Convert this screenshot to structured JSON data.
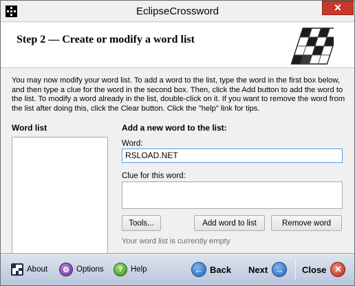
{
  "window": {
    "title": "EclipseCrossword",
    "close_glyph": "✕"
  },
  "header": {
    "title": "Step 2 — Create or modify a word list",
    "logo_icon": "crossword-grid-logo"
  },
  "instructions": "You may now modify your word list.  To add a word to the list, type the word in the first box below, and then type a clue for the word in the second box.  Then, click the Add button to add the word to the list.  To modify a word already in the list, double-click on it.  If you want to remove the word from the list after doing this, click the Clear button.  Click the \"help\" link for tips.",
  "word_list": {
    "label": "Word list",
    "items": []
  },
  "add_panel": {
    "heading": "Add a new word to the list:",
    "word_label": "Word:",
    "word_value": "RSLOAD.NET",
    "clue_label": "Clue for this word:",
    "clue_value": "",
    "tools_label": "Tools...",
    "add_label": "Add word to list",
    "remove_label": "Remove word",
    "status": "Your word list is currently empty"
  },
  "footer": {
    "about": {
      "label": "About",
      "icon": "crossword-icon"
    },
    "options": {
      "label": "Options",
      "icon": "options-icon"
    },
    "help": {
      "label": "Help",
      "icon": "help-icon"
    },
    "back": {
      "label": "Back",
      "icon": "back-arrow-icon",
      "glyph": "←"
    },
    "next": {
      "label": "Next",
      "icon": "next-arrow-icon",
      "glyph": "→"
    },
    "close": {
      "label": "Close",
      "icon": "close-x-icon",
      "glyph": "✕"
    }
  },
  "colors": {
    "title_close": "#c7392b",
    "footer_gradient_top": "#dde4ef",
    "footer_gradient_bottom": "#b9c6dc",
    "focus_border": "#569de5"
  }
}
